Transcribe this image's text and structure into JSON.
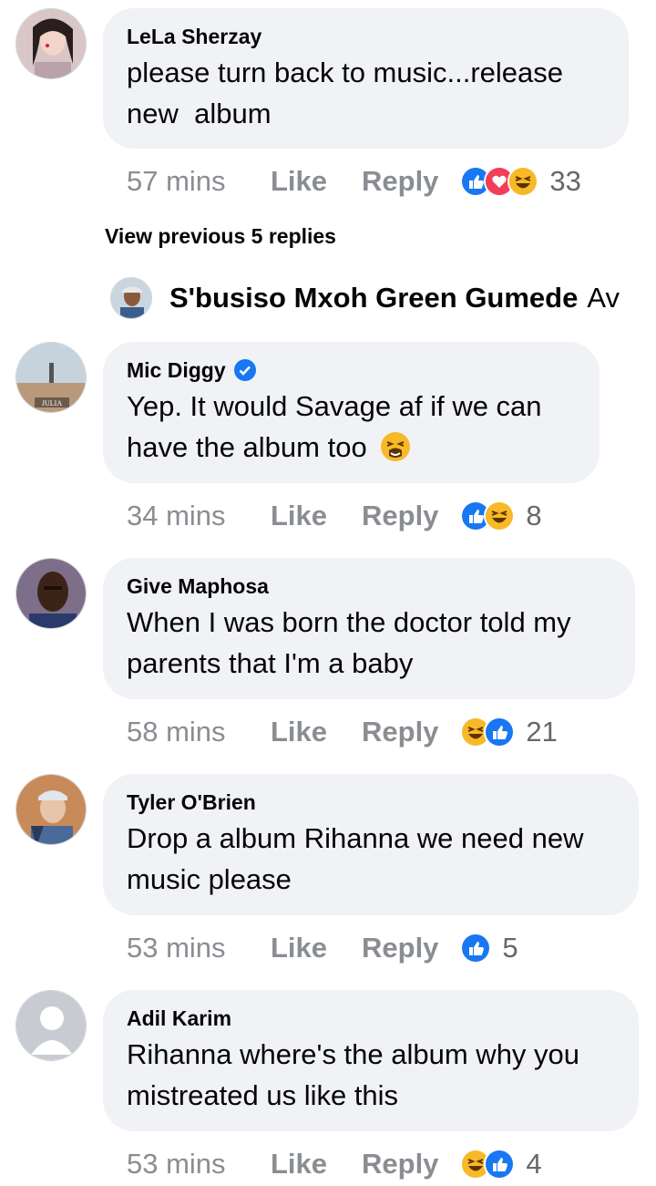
{
  "comments": [
    {
      "name": "LeLa Sherzay",
      "verified": false,
      "lines": [
        "please turn back to music...release",
        "new  album"
      ],
      "time": "57 mins",
      "like": "Like",
      "reply": "Reply",
      "reactions": [
        "like",
        "love",
        "haha"
      ],
      "count": "33"
    },
    {
      "name": "Mic Diggy",
      "verified": true,
      "lines": [
        "Yep. It would Savage af if we can",
        "have the album too"
      ],
      "emoji": "tired-face",
      "time": "34 mins",
      "like": "Like",
      "reply": "Reply",
      "reactions": [
        "like",
        "haha"
      ],
      "count": "8",
      "avatar_caption": "JULIA"
    },
    {
      "name": "Give Maphosa",
      "verified": false,
      "lines": [
        "When I was born the doctor told my",
        "parents that I'm a baby"
      ],
      "time": "58 mins",
      "like": "Like",
      "reply": "Reply",
      "reactions": [
        "haha",
        "like"
      ],
      "count": "21"
    },
    {
      "name": "Tyler O'Brien",
      "verified": false,
      "lines": [
        "Drop a album Rihanna we need new",
        "music please"
      ],
      "time": "53 mins",
      "like": "Like",
      "reply": "Reply",
      "reactions": [
        "like"
      ],
      "count": "5"
    },
    {
      "name": "Adil Karim",
      "verified": false,
      "lines": [
        "Rihanna where's the album why you",
        "mistreated us like this"
      ],
      "time": "53 mins",
      "like": "Like",
      "reply": "Reply",
      "reactions": [
        "haha",
        "like"
      ],
      "count": "4"
    }
  ],
  "view_previous": "View previous 5 replies",
  "nested_reply": {
    "name": "S'busiso Mxoh Green Gumede",
    "text_start": "Av"
  },
  "colors": {
    "bubble": "#f0f2f5",
    "meta": "#8a8d91",
    "like_blue": "#1877f2",
    "love_red": "#f33e58",
    "haha_yellow": "#f7b928",
    "verified": "#1877f2"
  }
}
